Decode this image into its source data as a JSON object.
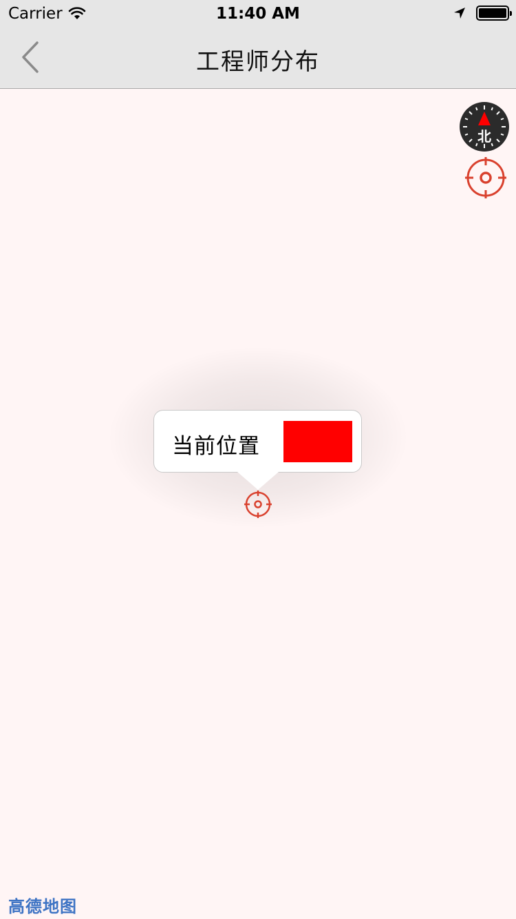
{
  "status_bar": {
    "carrier": "Carrier",
    "time": "11:40 AM"
  },
  "nav": {
    "title": "工程师分布"
  },
  "map": {
    "compass_label": "北",
    "callout_text": "当前位置",
    "callout_swatch_color": "#ff0000",
    "marker_color": "#d9412e",
    "logo": "高德地图"
  },
  "colors": {
    "nav_background": "#e6e6e6",
    "map_background": "#fff5f5",
    "accent": "#d9412e",
    "logo": "#3d73c4"
  }
}
